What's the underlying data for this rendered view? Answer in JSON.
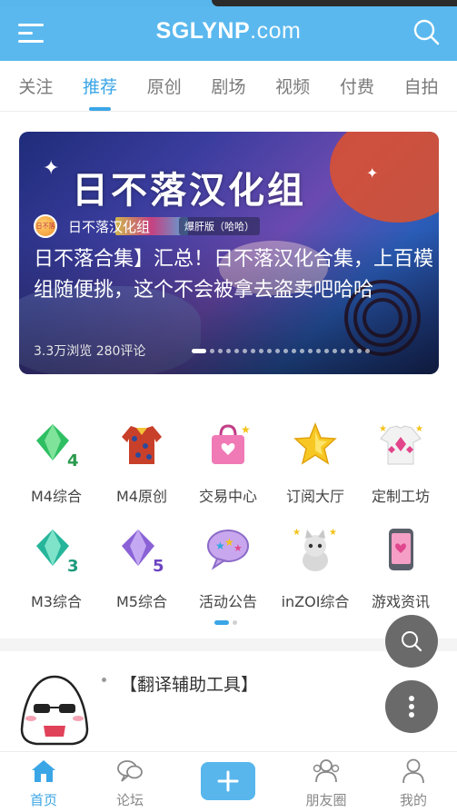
{
  "header": {
    "logo_main": "SGLYNP",
    "logo_suffix": ".com",
    "menu_icon": "menu-icon",
    "search_icon": "search-icon",
    "bg_color": "#5ab8ee"
  },
  "tabs": [
    {
      "label": "关注",
      "active": false
    },
    {
      "label": "推荐",
      "active": true
    },
    {
      "label": "原创",
      "active": false
    },
    {
      "label": "剧场",
      "active": false
    },
    {
      "label": "视频",
      "active": false
    },
    {
      "label": "付费",
      "active": false
    },
    {
      "label": "自拍",
      "active": false
    }
  ],
  "banner": {
    "image_title": "日不落汉化组",
    "author": "日不落汉化组",
    "sub_tag": "爆肝版（哈哈）",
    "headline": "日不落合集】汇总！日不落汉化合集，上百模组随便挑，这个不会被拿去盗卖吧哈哈",
    "meta": "3.3万浏览  280评论",
    "slide_count": 21,
    "active_slide": 1
  },
  "grid": [
    {
      "label": "M4综合",
      "icon": "green-gem-4-icon"
    },
    {
      "label": "M4原创",
      "icon": "jacket-icon"
    },
    {
      "label": "交易中心",
      "icon": "shopping-bag-icon"
    },
    {
      "label": "订阅大厅",
      "icon": "star-icon"
    },
    {
      "label": "定制工坊",
      "icon": "sweater-icon"
    },
    {
      "label": "M3综合",
      "icon": "green-gem-3-icon"
    },
    {
      "label": "M5综合",
      "icon": "purple-gem-5-icon"
    },
    {
      "label": "活动公告",
      "icon": "speech-bubble-icon"
    },
    {
      "label": "inZOI综合",
      "icon": "cat-icon"
    },
    {
      "label": "游戏资讯",
      "icon": "phone-icon"
    }
  ],
  "grid_pages": 2,
  "grid_active_page": 1,
  "feed": {
    "title": "【翻译辅助工具】",
    "avatar_icon": "mascot-avatar-icon"
  },
  "fab": {
    "search_icon": "search-icon",
    "more_icon": "more-vertical-icon"
  },
  "bottom_nav": [
    {
      "label": "首页",
      "icon": "home-icon",
      "active": true
    },
    {
      "label": "论坛",
      "icon": "forum-icon",
      "active": false
    },
    {
      "label": "",
      "icon": "plus-icon",
      "active": false
    },
    {
      "label": "朋友圈",
      "icon": "friends-icon",
      "active": false
    },
    {
      "label": "我的",
      "icon": "user-icon",
      "active": false
    }
  ],
  "accent_color": "#3ba6e6"
}
